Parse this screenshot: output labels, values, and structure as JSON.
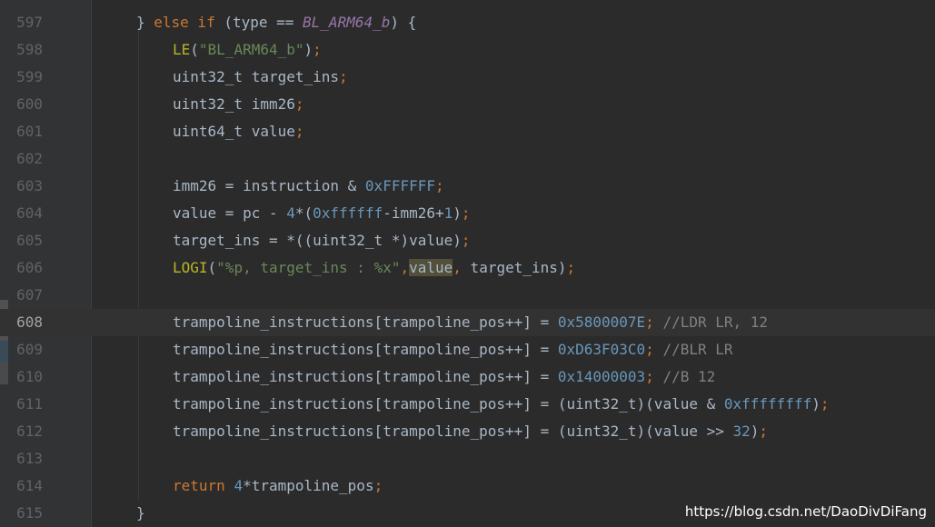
{
  "editor": {
    "lines": [
      {
        "num": "597",
        "indent": 0,
        "segs": [
          {
            "t": "} ",
            "c": ""
          },
          {
            "t": "else if",
            "c": "kw"
          },
          {
            "t": " (type == ",
            "c": ""
          },
          {
            "t": "BL_ARM64_b",
            "c": "cst"
          },
          {
            "t": ") {",
            "c": ""
          }
        ]
      },
      {
        "num": "598",
        "indent": 1,
        "segs": [
          {
            "t": "LE",
            "c": "mac"
          },
          {
            "t": "(",
            "c": ""
          },
          {
            "t": "\"BL_ARM64_b\"",
            "c": "str"
          },
          {
            "t": ")",
            "c": ""
          },
          {
            "t": ";",
            "c": "kw"
          }
        ]
      },
      {
        "num": "599",
        "indent": 1,
        "segs": [
          {
            "t": "uint32_t target_ins",
            "c": ""
          },
          {
            "t": ";",
            "c": "kw"
          }
        ]
      },
      {
        "num": "600",
        "indent": 1,
        "segs": [
          {
            "t": "uint32_t imm26",
            "c": ""
          },
          {
            "t": ";",
            "c": "kw"
          }
        ]
      },
      {
        "num": "601",
        "indent": 1,
        "segs": [
          {
            "t": "uint64_t value",
            "c": ""
          },
          {
            "t": ";",
            "c": "kw"
          }
        ]
      },
      {
        "num": "602",
        "indent": 0,
        "segs": []
      },
      {
        "num": "603",
        "indent": 1,
        "segs": [
          {
            "t": "imm26 = instruction & ",
            "c": ""
          },
          {
            "t": "0xFFFFFF",
            "c": "num"
          },
          {
            "t": ";",
            "c": "kw"
          }
        ]
      },
      {
        "num": "604",
        "indent": 1,
        "segs": [
          {
            "t": "value = pc - ",
            "c": ""
          },
          {
            "t": "4",
            "c": "num"
          },
          {
            "t": "*(",
            "c": ""
          },
          {
            "t": "0xffffff",
            "c": "num"
          },
          {
            "t": "-imm26+",
            "c": ""
          },
          {
            "t": "1",
            "c": "num"
          },
          {
            "t": ")",
            "c": ""
          },
          {
            "t": ";",
            "c": "kw"
          }
        ]
      },
      {
        "num": "605",
        "indent": 1,
        "segs": [
          {
            "t": "target_ins = *((uint32_t *)value)",
            "c": ""
          },
          {
            "t": ";",
            "c": "kw"
          }
        ]
      },
      {
        "num": "606",
        "indent": 1,
        "segs": [
          {
            "t": "LOGI",
            "c": "mac"
          },
          {
            "t": "(",
            "c": ""
          },
          {
            "t": "\"%p, target_ins : %x\"",
            "c": "str"
          },
          {
            "t": ",",
            "c": "kw"
          },
          {
            "t": "value",
            "c": "hl"
          },
          {
            "t": ",",
            "c": "kw"
          },
          {
            "t": " target_ins)",
            "c": ""
          },
          {
            "t": ";",
            "c": "kw"
          }
        ]
      },
      {
        "num": "607",
        "indent": 0,
        "segs": []
      },
      {
        "num": "608",
        "indent": 1,
        "current": true,
        "segs": [
          {
            "t": "trampoline_instructions[trampoline_pos++] = ",
            "c": ""
          },
          {
            "t": "0x5800007E",
            "c": "num"
          },
          {
            "t": ";",
            "c": "kw"
          },
          {
            "t": " //LDR LR, 12",
            "c": "cmt"
          }
        ]
      },
      {
        "num": "609",
        "indent": 1,
        "segs": [
          {
            "t": "trampoline_instructions[trampoline_pos++] = ",
            "c": ""
          },
          {
            "t": "0xD63F03C0",
            "c": "num"
          },
          {
            "t": ";",
            "c": "kw"
          },
          {
            "t": " //BLR LR",
            "c": "cmt"
          }
        ]
      },
      {
        "num": "610",
        "indent": 1,
        "segs": [
          {
            "t": "trampoline_instructions[trampoline_pos++] = ",
            "c": ""
          },
          {
            "t": "0x14000003",
            "c": "num"
          },
          {
            "t": ";",
            "c": "kw"
          },
          {
            "t": " //B 12",
            "c": "cmt"
          }
        ]
      },
      {
        "num": "611",
        "indent": 1,
        "segs": [
          {
            "t": "trampoline_instructions[trampoline_pos++] = (uint32_t)(value & ",
            "c": ""
          },
          {
            "t": "0xffffffff",
            "c": "num"
          },
          {
            "t": ")",
            "c": ""
          },
          {
            "t": ";",
            "c": "kw"
          }
        ]
      },
      {
        "num": "612",
        "indent": 1,
        "segs": [
          {
            "t": "trampoline_instructions[trampoline_pos++] = (uint32_t)(value >> ",
            "c": ""
          },
          {
            "t": "32",
            "c": "num"
          },
          {
            "t": ")",
            "c": ""
          },
          {
            "t": ";",
            "c": "kw"
          }
        ]
      },
      {
        "num": "613",
        "indent": 0,
        "segs": []
      },
      {
        "num": "614",
        "indent": 1,
        "segs": [
          {
            "t": "return ",
            "c": "kw"
          },
          {
            "t": "4",
            "c": "num"
          },
          {
            "t": "*trampoline_pos",
            "c": ""
          },
          {
            "t": ";",
            "c": "kw"
          }
        ]
      },
      {
        "num": "615",
        "indent": 0,
        "segs": [
          {
            "t": "}",
            "c": ""
          }
        ]
      }
    ]
  },
  "watermark": "https://blog.csdn.net/DaoDivDiFang",
  "colors": {
    "background": "#2b2b2b",
    "gutter": "#313335",
    "default_text": "#a9b7c6",
    "keyword": "#cc7832",
    "macro": "#bbb529",
    "string": "#6a8759",
    "number": "#6897bb",
    "constant": "#9876aa",
    "comment": "#808080",
    "usage_highlight": "#52503a"
  }
}
